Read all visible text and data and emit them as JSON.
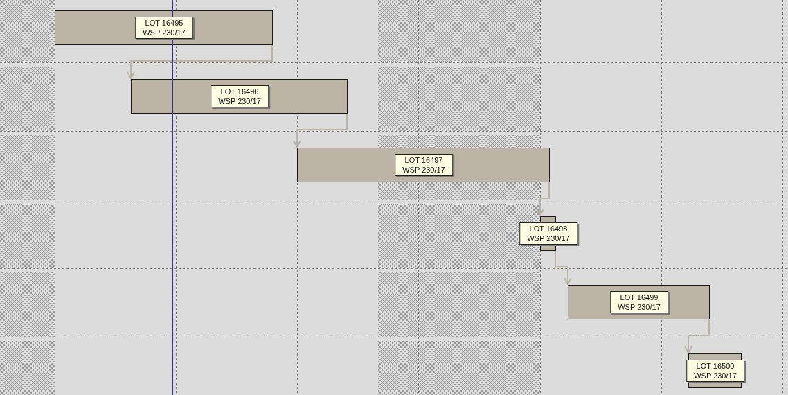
{
  "tasks": [
    {
      "lot": "LOT 16495",
      "order": "WSP 230/17"
    },
    {
      "lot": "LOT 16496",
      "order": "WSP 230/17"
    },
    {
      "lot": "LOT 16497",
      "order": "WSP 230/17"
    },
    {
      "lot": "LOT 16498",
      "order": "WSP 230/17"
    },
    {
      "lot": "LOT 16499",
      "order": "WSP 230/17"
    },
    {
      "lot": "LOT 16500",
      "order": "WSP 230/17"
    }
  ]
}
